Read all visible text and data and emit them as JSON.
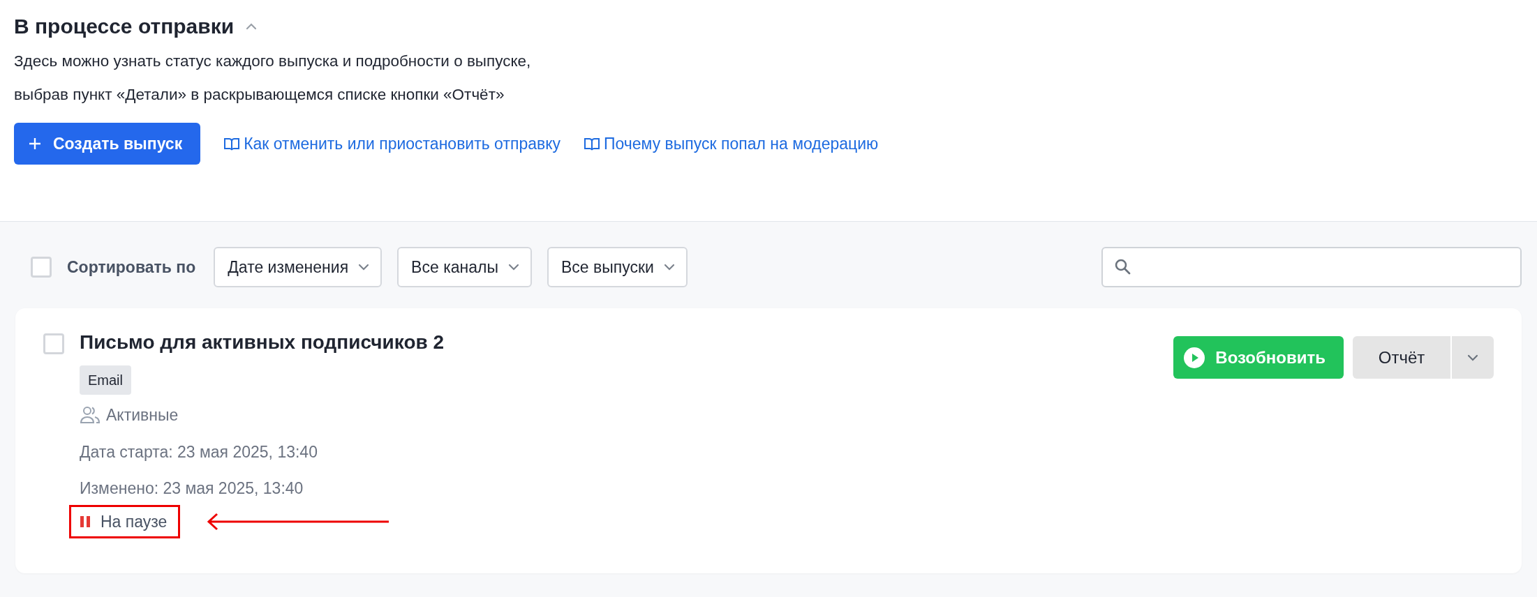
{
  "section": {
    "title": "В процессе отправки",
    "expanded": true,
    "description": "Здесь можно узнать статус каждого выпуска и подробности о выпуске,\nвыбрав пункт «Детали» в раскрывающемся списке кнопки «Отчёт»"
  },
  "create_button": {
    "label": "Создать выпуск"
  },
  "help_links": [
    {
      "label": "Как отменить или приостановить отправку"
    },
    {
      "label": "Почему выпуск попал на модерацию"
    }
  ],
  "toolbar": {
    "select_all": {
      "checked": false
    },
    "sort_label": "Сортировать по",
    "dropdowns": [
      {
        "value": "Дате изменения"
      },
      {
        "value": "Все каналы"
      },
      {
        "value": "Все выпуски"
      }
    ]
  },
  "campaigns": [
    {
      "checked": false,
      "title": "Письмо для активных подписчиков 2",
      "channel": "Email",
      "segment": "Активные",
      "start_date": "Дата старта: 23 мая 2025, 13:40",
      "modified": "Изменено: 23 мая 2025, 13:40",
      "status": {
        "kind": "paused",
        "text": "На паузе",
        "highlighted": true
      },
      "resume_button": "Возобновить",
      "report_button": "Отчёт"
    }
  ]
}
